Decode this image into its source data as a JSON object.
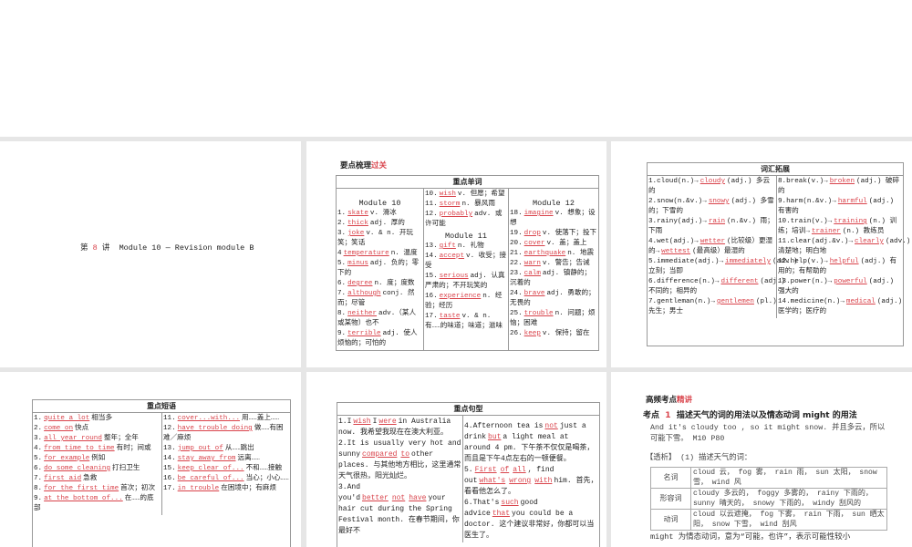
{
  "slide1": {
    "prefix": "第",
    "num": "8",
    "mid": "讲",
    "title": "Module 10 — Revision module B"
  },
  "slide2": {
    "section": "要点梳理",
    "section_red": "过关",
    "table_title": "重点单词",
    "col1_heading": "Module 10",
    "col2_heading": "Module 11",
    "col3_heading": "Module 12",
    "col1": [
      [
        "1.",
        {
          "a": "skate"
        },
        "v. 滑冰"
      ],
      [
        "2.",
        {
          "a": "thick"
        },
        "adj. 厚的"
      ],
      [
        "3.",
        {
          "a": "joke"
        },
        "v. & n. 开玩笑；笑话"
      ],
      [
        "4",
        {
          "a": "temperature"
        },
        "n. 温度"
      ],
      [
        "5.",
        {
          "a": "minus"
        },
        "adj. 负的；零下的"
      ],
      [
        "6.",
        {
          "a": "degree"
        },
        "n. 度；度数"
      ],
      [
        "7.",
        {
          "a": "although"
        },
        "conj. 然而；尽管"
      ],
      [
        "8.",
        {
          "a": "neither"
        },
        "adv.（某人或某物）也不"
      ],
      [
        "9.",
        {
          "a": "terrible"
        },
        "adj. 使人烦恼的；可怕的"
      ]
    ],
    "col2a": [
      [
        "10.",
        {
          "a": "wish"
        },
        "v. 但愿；希望"
      ],
      [
        "11.",
        {
          "a": "storm"
        },
        "n. 暴风雨"
      ],
      [
        "12.",
        {
          "a": "probably"
        },
        "adv. 或许可能"
      ]
    ],
    "col2b": [
      [
        "13.",
        {
          "a": "gift"
        },
        "n. 礼物"
      ],
      [
        "14.",
        {
          "a": "accept"
        },
        "v. 收受；接受"
      ],
      [
        "15.",
        {
          "a": "serious"
        },
        "adj. 认真严肃的；不开玩笑的"
      ],
      [
        "16.",
        {
          "a": "experience"
        },
        "n. 经验；经历"
      ],
      [
        "17.",
        {
          "a": "taste"
        },
        "v. & n. 有……的味道；味道；滋味"
      ]
    ],
    "col3": [
      [
        "18.",
        {
          "a": "imagine"
        },
        "v. 想象；设想"
      ],
      [
        "19.",
        {
          "a": "drop"
        },
        "v. 使落下；投下"
      ],
      [
        "20.",
        {
          "a": "cover"
        },
        "v. 盖；盖上"
      ],
      [
        "21.",
        {
          "a": "earthquake"
        },
        "n. 地震"
      ],
      [
        "22.",
        {
          "a": "warn"
        },
        "v. 警告；告诫"
      ],
      [
        "23.",
        {
          "a": "calm"
        },
        "adj. 镇静的；沉着的"
      ],
      [
        "24.",
        {
          "a": "brave"
        },
        "adj. 勇敢的；无畏的"
      ],
      [
        "25.",
        {
          "a": "trouble"
        },
        "n. 问题；烦恼；困难"
      ],
      [
        "26.",
        {
          "a": "keep"
        },
        "v. 保持；留在"
      ]
    ]
  },
  "slide3": {
    "table_title": "词汇拓展",
    "col1": [
      [
        "1.cloud(n.)→",
        {
          "a": "cloudy"
        },
        "(adj.) 多云的"
      ],
      [
        "2.snow(n.&v.)→",
        {
          "a": "snowy"
        },
        "(adj.) 多雪的；下雪的"
      ],
      [
        "3.rainy(adj.)→",
        {
          "a": "rain"
        },
        "(n.&v.) 雨；下雨"
      ],
      [
        "4.wet(adj.)→",
        {
          "a": "wetter"
        },
        "(比较级）更湿的→",
        {
          "a": "wettest"
        },
        "(最高级）最湿的"
      ],
      [
        "5.immediate(adj.)→",
        {
          "a": "immediately"
        },
        "(adv.) 立刻；当即"
      ],
      [
        "6.difference(n.)→",
        {
          "a": "different"
        },
        "(adj.) 不同的；相异的"
      ],
      [
        "7.gentleman(n.)→",
        {
          "a": "gentlemen"
        },
        "(pl.) 先生；男士"
      ]
    ],
    "col2": [
      [
        "8.break(v.)→",
        {
          "a": "broken"
        },
        "(adj.) 破碎的"
      ],
      [
        "9.harm(n.&v.)→",
        {
          "a": "harmful"
        },
        "(adj.) 有害的"
      ],
      [
        "10.train(v.)→",
        {
          "a": "training"
        },
        "(n.) 训练；培训→",
        {
          "a": "trainer"
        },
        "(n.) 教练员"
      ],
      [
        "11.clear(adj.&v.)→",
        {
          "a": "clearly"
        },
        "(adv.) 清楚地；明白地"
      ],
      [
        "12.help(v.)→",
        {
          "a": "helpful"
        },
        "(adj.) 有用的；有帮助的"
      ],
      [
        "13.power(n.)→",
        {
          "a": "powerful"
        },
        "(adj.) 强大的"
      ],
      [
        "14.medicine(n.)→",
        {
          "a": "medical"
        },
        "(adj.) 医学的；医疗的"
      ]
    ]
  },
  "slide4": {
    "table_title": "重点短语",
    "col1": [
      [
        "1.",
        {
          "a": "quite a lot"
        },
        "相当多"
      ],
      [
        "2.",
        {
          "a": "come on"
        },
        "快点"
      ],
      [
        "3.",
        {
          "a": "all year round"
        },
        "整年；全年"
      ],
      [
        "4.",
        {
          "a": "from time to time"
        },
        "有时；间或"
      ],
      [
        "5.",
        {
          "a": "for example"
        },
        "例如"
      ],
      [
        "6.",
        {
          "a": "do some cleaning"
        },
        "打扫卫生"
      ],
      [
        "7.",
        {
          "a": "first aid"
        },
        "急救"
      ],
      [
        "8.",
        {
          "a": "for the first time"
        },
        "首次；初次"
      ],
      [
        "9.",
        {
          "a": "at the bottom of..."
        },
        "在……的底部"
      ]
    ],
    "col2": [
      [
        "11.",
        {
          "a": "cover...with..."
        },
        "用……盖上……"
      ],
      [
        "12.",
        {
          "a": "have trouble doing"
        },
        "做……有困难／麻烦"
      ],
      [
        "13.",
        {
          "a": "jump out of"
        },
        "从……跳出"
      ],
      [
        "14.",
        {
          "a": "stay away from"
        },
        "远离……"
      ],
      [
        "15.",
        {
          "a": "keep clear of..."
        },
        "不和……接触"
      ],
      [
        "16.",
        {
          "a": "be careful of..."
        },
        "当心；小心……"
      ],
      [
        "17.",
        {
          "a": "in trouble"
        },
        "在困境中；有麻烦"
      ]
    ]
  },
  "slide5": {
    "table_title": "重点句型",
    "col1": [
      [
        "1.I",
        {
          "a": "wish"
        },
        "I",
        {
          "a": "were"
        },
        "in Australia now. 我希望我现在在澳大利亚。"
      ],
      [
        "2.It is usually very hot and sunny",
        {
          "a": "compared"
        },
        {
          "a": "to"
        },
        "other places. 与其他地方相比，这里通常天气很热，阳光灿烂。"
      ],
      [
        "3.And you'd",
        {
          "a": "better"
        },
        {
          "a": "not"
        },
        {
          "a": "have"
        },
        "your hair cut during the Spring Festival month. 在春节期间，你最好不"
      ]
    ],
    "col2": [
      [
        "4.Afternoon tea is",
        {
          "a": "not"
        },
        "just a drink",
        {
          "a": "but"
        },
        "a light meal at around 4 pm. 下午茶不仅仅是喝茶，而且是下午4点左右的一顿便餐。"
      ],
      [
        "5.",
        {
          "a": "First"
        },
        {
          "a": "of"
        },
        {
          "a": "all"
        },
        ", find out",
        {
          "a": "what's"
        },
        {
          "a": "wrong"
        },
        {
          "a": "with"
        },
        "him. 首先，看看他怎么了。"
      ],
      [
        "6.That's",
        {
          "a": "such"
        },
        "good advice",
        {
          "a": "that"
        },
        "you could be a doctor. 这个建议非常好，你都可以当医生了。"
      ]
    ]
  },
  "slide6": {
    "section": "高频考点",
    "section_red": "精讲",
    "point_label": "考点",
    "point_num": "1",
    "point_title": "描述天气的词的用法以及情态动词 might 的用法",
    "example": "And it's cloudy too , so it might snow. 并且多云，所以可能下雪。 M10 P80",
    "analysis": "【透析】 (1) 描述天气的词：",
    "rows": [
      {
        "k": "名词",
        "v": "cloud 云， fog 雾， rain 雨， sun 太阳， snow 雪， wind 风"
      },
      {
        "k": "形容词",
        "v": "cloudy 多云的， foggy 多雾的， rainy 下雨的， sunny 晴天的， snowy 下雨的， windy 刮风的"
      },
      {
        "k": "动词",
        "v": "cloud 以云遮掩， fog 下雾， rain 下雨， sun 晒太阳， snow 下雪， wind 刮风"
      }
    ],
    "tail": "might 为情态动词，意为“可能，也许”，表示可能性较小"
  }
}
